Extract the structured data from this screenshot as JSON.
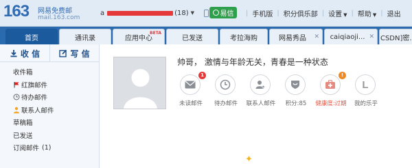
{
  "header": {
    "logo_number": "163",
    "logo_text": "网易免费邮",
    "logo_sub": "mail.163.com",
    "user_initial": "a",
    "user_count": "(18)",
    "yixin_label": "易信",
    "links": [
      {
        "label": "手机版",
        "dropdown": false
      },
      {
        "label": "积分俱乐部",
        "dropdown": false
      },
      {
        "label": "设置",
        "dropdown": true
      },
      {
        "label": "帮助",
        "dropdown": true
      },
      {
        "label": "退出",
        "dropdown": false
      }
    ]
  },
  "tabs": [
    {
      "label": "首页",
      "active": true,
      "closable": false
    },
    {
      "label": "通讯录",
      "active": false,
      "closable": false
    },
    {
      "label": "应用中心",
      "active": false,
      "closable": false,
      "badge": "BETA"
    },
    {
      "label": "已发送",
      "active": false,
      "closable": false
    },
    {
      "label": "考拉海购",
      "active": false,
      "closable": false
    },
    {
      "label": "网易秀品",
      "active": false,
      "closable": true
    },
    {
      "label": "caiqiaoji...",
      "active": false,
      "closable": true
    },
    {
      "label": "[CSDN]密...",
      "active": false,
      "closable": false
    }
  ],
  "sidebar": {
    "receive_label": "收 信",
    "write_label": "写 信",
    "items": [
      {
        "label": "收件箱",
        "icon": ""
      },
      {
        "label": "红旗邮件",
        "icon": "red-flag-icon"
      },
      {
        "label": "待办邮件",
        "icon": "clock-icon"
      },
      {
        "label": "联系人邮件",
        "icon": "contact-icon"
      },
      {
        "label": "草稿箱",
        "icon": ""
      },
      {
        "label": "已发送",
        "icon": ""
      },
      {
        "label": "订阅邮件",
        "icon": "",
        "count": "(1)"
      }
    ]
  },
  "main": {
    "motto": "帅哥， 激情与年龄无关，青春是一种状态",
    "stats": [
      {
        "label": "未读邮件",
        "icon": "mail-icon",
        "badge": "1",
        "badge_color": "#e63939"
      },
      {
        "label": "待办邮件",
        "icon": "clock-icon",
        "badge": "",
        "badge_color": ""
      },
      {
        "label": "联系人邮件",
        "icon": "contact-star-icon",
        "badge": "",
        "badge_color": ""
      },
      {
        "label": "积分:85",
        "icon": "points-icon",
        "badge": "",
        "badge_color": ""
      },
      {
        "label": "健康度:过期",
        "icon": "health-kit-icon",
        "badge": "!",
        "badge_color": "#f08a24"
      },
      {
        "label": "我的乐乎",
        "icon": "lofter-icon",
        "badge": "",
        "badge_color": ""
      }
    ]
  },
  "colors": {
    "topbar_bg": "#e1ebf6",
    "tabbar_bg": "#2a6aae",
    "active_tab": "#1c5a9e",
    "yixin_green": "#2e9f4a",
    "redaction_red": "#e63939",
    "alert_orange": "#f08a24"
  }
}
